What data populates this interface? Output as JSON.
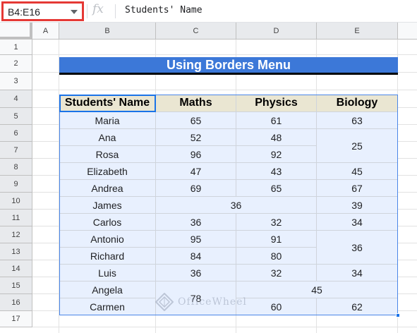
{
  "formula_bar": {
    "name_box": "B4:E16",
    "fx_label": "fx",
    "formula": "Students' Name"
  },
  "columns": [
    "A",
    "B",
    "C",
    "D",
    "E"
  ],
  "rows": [
    "1",
    "2",
    "3",
    "4",
    "5",
    "6",
    "7",
    "8",
    "9",
    "10",
    "11",
    "12",
    "13",
    "14",
    "15",
    "16",
    "17"
  ],
  "title": "Using Borders Menu",
  "table": {
    "headers": [
      "Students' Name",
      "Maths",
      "Physics",
      "Biology"
    ],
    "rows": [
      {
        "name": "Maria",
        "maths": "65",
        "physics": "61",
        "biology": "63"
      },
      {
        "name": "Ana",
        "maths": "52",
        "physics": "48",
        "biology": ""
      },
      {
        "name": "Rosa",
        "maths": "96",
        "physics": "92",
        "biology": ""
      },
      {
        "name": "Elizabeth",
        "maths": "47",
        "physics": "43",
        "biology": "45"
      },
      {
        "name": "Andrea",
        "maths": "69",
        "physics": "65",
        "biology": "67"
      },
      {
        "name": "James",
        "maths": "",
        "physics": "",
        "biology": "39"
      },
      {
        "name": "Carlos",
        "maths": "36",
        "physics": "32",
        "biology": "34"
      },
      {
        "name": "Antonio",
        "maths": "95",
        "physics": "91",
        "biology": ""
      },
      {
        "name": "Richard",
        "maths": "84",
        "physics": "80",
        "biology": ""
      },
      {
        "name": "Luis",
        "maths": "36",
        "physics": "32",
        "biology": "34"
      },
      {
        "name": "Angela",
        "maths": "",
        "physics": "",
        "biology": ""
      },
      {
        "name": "Carmen",
        "maths": "",
        "physics": "60",
        "biology": "62"
      }
    ],
    "merged": {
      "ana_rosa_biology": "25",
      "james_maths_physics": "36",
      "antonio_richard_biology": "36",
      "angela_carmen_maths": "78",
      "angela_physics_biology": "45"
    }
  },
  "watermark": "OfficeWheel"
}
